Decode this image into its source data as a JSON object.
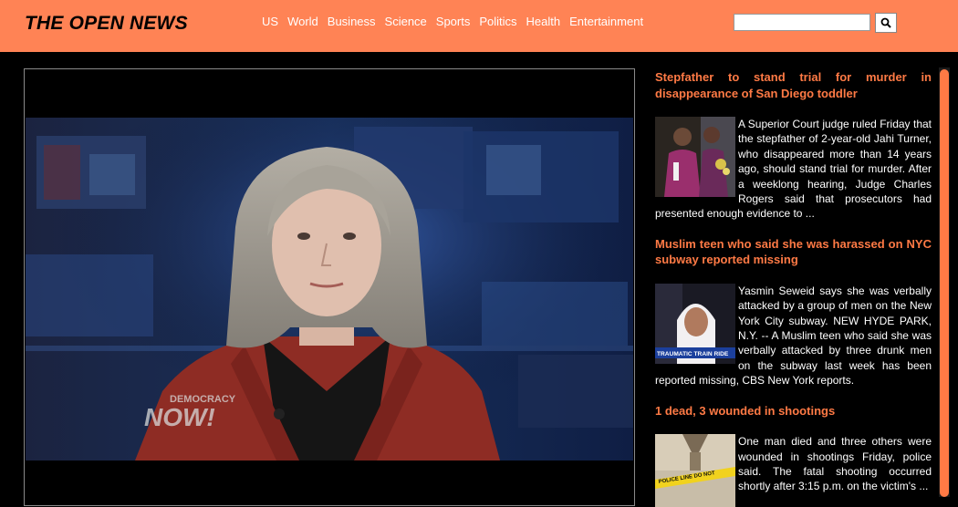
{
  "site": {
    "logo": "THE OPEN NEWS"
  },
  "nav": {
    "items": [
      "US",
      "World",
      "Business",
      "Science",
      "Sports",
      "Politics",
      "Health",
      "Entertainment"
    ]
  },
  "search": {
    "placeholder": "",
    "value": "",
    "icon": "search-icon"
  },
  "video": {
    "watermark_top": "DEMOCRACY",
    "watermark_bottom": "NOW!"
  },
  "articles": [
    {
      "headline": "Stepfather to stand trial for murder in disappearance of San Diego toddler",
      "summary": "A Superior Court judge ruled Friday that the stepfather of 2-year-old Jahi Turner, who disappeared more than 14 years ago, should stand trial for murder. After a weeklong hearing, Judge Charles Rogers said that prosecutors had presented enough evidence to ..."
    },
    {
      "headline": "Muslim teen who said she was harassed on NYC subway reported missing",
      "thumb_caption": "TRAUMATIC TRAIN RIDE",
      "summary": "Yasmin Seweid says she was verbally attacked by a group of men on the New York City subway. NEW HYDE PARK, N.Y. -- A Muslim teen who said she was verbally attacked by three drunk men on the subway last week has been reported missing, CBS New York reports."
    },
    {
      "headline": "1 dead, 3 wounded in shootings",
      "thumb_caption": "POLICE LINE DO NOT",
      "summary": "One man died and three others were wounded in shootings Friday, police said. The fatal shooting occurred shortly after 3:15 p.m. on the victim's ..."
    }
  ],
  "colors": {
    "header_bg": "#ff8355",
    "accent": "#ff7a45",
    "page_bg": "#000000"
  }
}
